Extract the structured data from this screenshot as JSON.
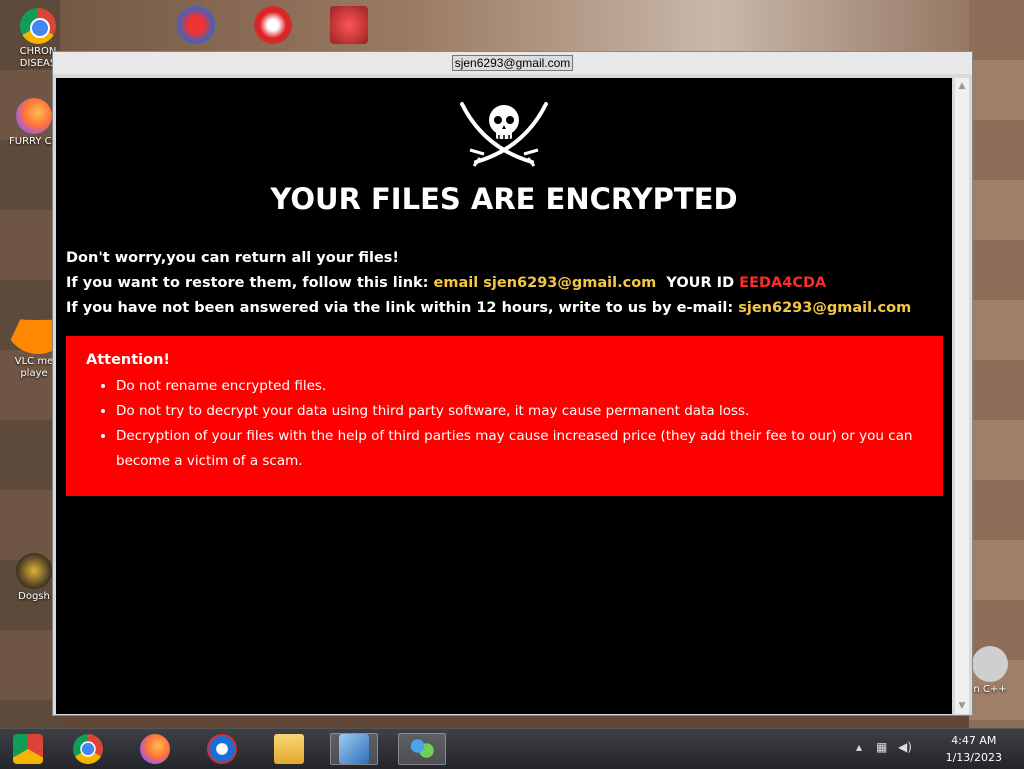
{
  "desktop": {
    "icons": [
      {
        "label": "CHRON\nDISEAS",
        "icon": "chrome-icon"
      },
      {
        "label": "FURRY CU",
        "icon": "firefox-icon"
      },
      {
        "label": "VLC me\nplaye",
        "icon": "vlc-icon"
      },
      {
        "label": "Dogsh",
        "icon": "dog-icon"
      },
      {
        "label": "n C++",
        "icon": "recycle-bin-icon"
      }
    ]
  },
  "window": {
    "title": "sjen6293@gmail.com",
    "headline": "YOUR FILES ARE ENCRYPTED",
    "line1": "Don't worry,you can return all your files!",
    "line2_prefix": "If you want to restore them, follow this link:",
    "line2_link": "email sjen6293@gmail.com",
    "line2_id_label": "YOUR ID",
    "line2_id": "EEDA4CDA",
    "line3_prefix": "If you have not been answered via the link within 12 hours, write to us by e-mail:",
    "line3_email": "sjen6293@gmail.com",
    "attention": {
      "title": "Attention!",
      "items": [
        "Do not rename encrypted files.",
        "Do not try to decrypt your data using third party software, it may cause permanent data loss.",
        "Decryption of your files with the help of third parties may cause increased price (they add their fee to our) or you can become a victim of a scam."
      ]
    }
  },
  "taskbar": {
    "items": [
      "chrome-folder-icon",
      "chrome-icon",
      "firefox-icon",
      "opera-icon",
      "file-explorer-icon",
      "setup-icon",
      "network-people-icon"
    ],
    "clock_time": "4:47 AM",
    "clock_date": "1/13/2023"
  },
  "colors": {
    "alert_bg": "#ff0000",
    "link_yellow": "#f6c744",
    "id_red": "#ff2a2a",
    "content_bg": "#000000"
  }
}
